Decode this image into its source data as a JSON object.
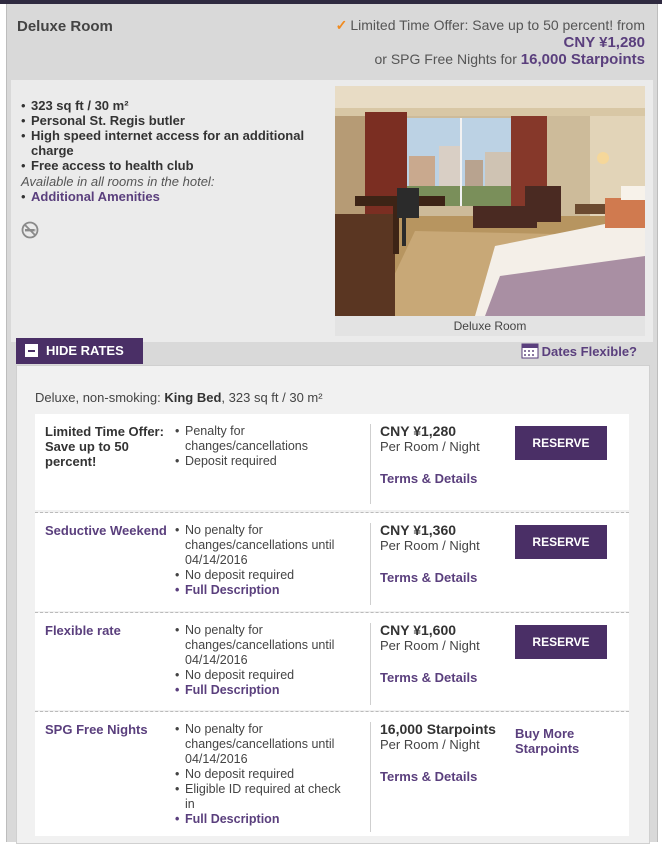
{
  "room": {
    "title": "Deluxe Room",
    "offer_text": "Limited Time Offer: Save up to 50 percent! from",
    "price": "CNY ¥1,280",
    "spg_prefix": "or SPG Free Nights for",
    "spg_points": "16,000 Starpoints",
    "features": [
      "323 sq ft / 30 m²",
      "Personal St. Regis butler",
      "High speed internet access for an additional charge",
      "Free access to health club"
    ],
    "available_note": "Available in all rooms in the hotel:",
    "amenities_link": "Additional Amenities",
    "photo_caption": "Deluxe Room"
  },
  "controls": {
    "hide_rates": "HIDE RATES",
    "dates_flexible": "Dates Flexible?"
  },
  "rates_header": {
    "prefix": "Deluxe, non-smoking:",
    "bed": "King Bed",
    "suffix": ", 323 sq ft / 30 m²"
  },
  "rates": [
    {
      "name": "Limited Time Offer: Save up to 50 percent!",
      "policies": [
        "Penalty for changes/cancellations",
        "Deposit required"
      ],
      "price": "CNY ¥1,280",
      "per": "Per Room / Night",
      "terms": "Terms & Details",
      "action": "RESERVE"
    },
    {
      "name": "Seductive Weekend",
      "policies": [
        "No penalty for changes/cancellations until 04/14/2016",
        "No deposit required"
      ],
      "link": "Full Description",
      "price": "CNY ¥1,360",
      "per": "Per Room / Night",
      "terms": "Terms & Details",
      "action": "RESERVE"
    },
    {
      "name": "Flexible rate",
      "policies": [
        "No penalty for changes/cancellations until 04/14/2016",
        "No deposit required"
      ],
      "link": "Full Description",
      "price": "CNY ¥1,600",
      "per": "Per Room / Night",
      "terms": "Terms & Details",
      "action": "RESERVE"
    },
    {
      "name": "SPG Free Nights",
      "policies": [
        "No penalty for changes/cancellations until 04/14/2016",
        "No deposit required",
        "Eligible ID required at check in"
      ],
      "link": "Full Description",
      "price": "16,000 Starpoints",
      "per": "Per Room / Night",
      "terms": "Terms & Details",
      "action": "Buy More Starpoints"
    }
  ],
  "colors": {
    "accent_purple": "#4a2f66",
    "link_purple": "#5a3f7d",
    "check_orange": "#f08a1e"
  }
}
